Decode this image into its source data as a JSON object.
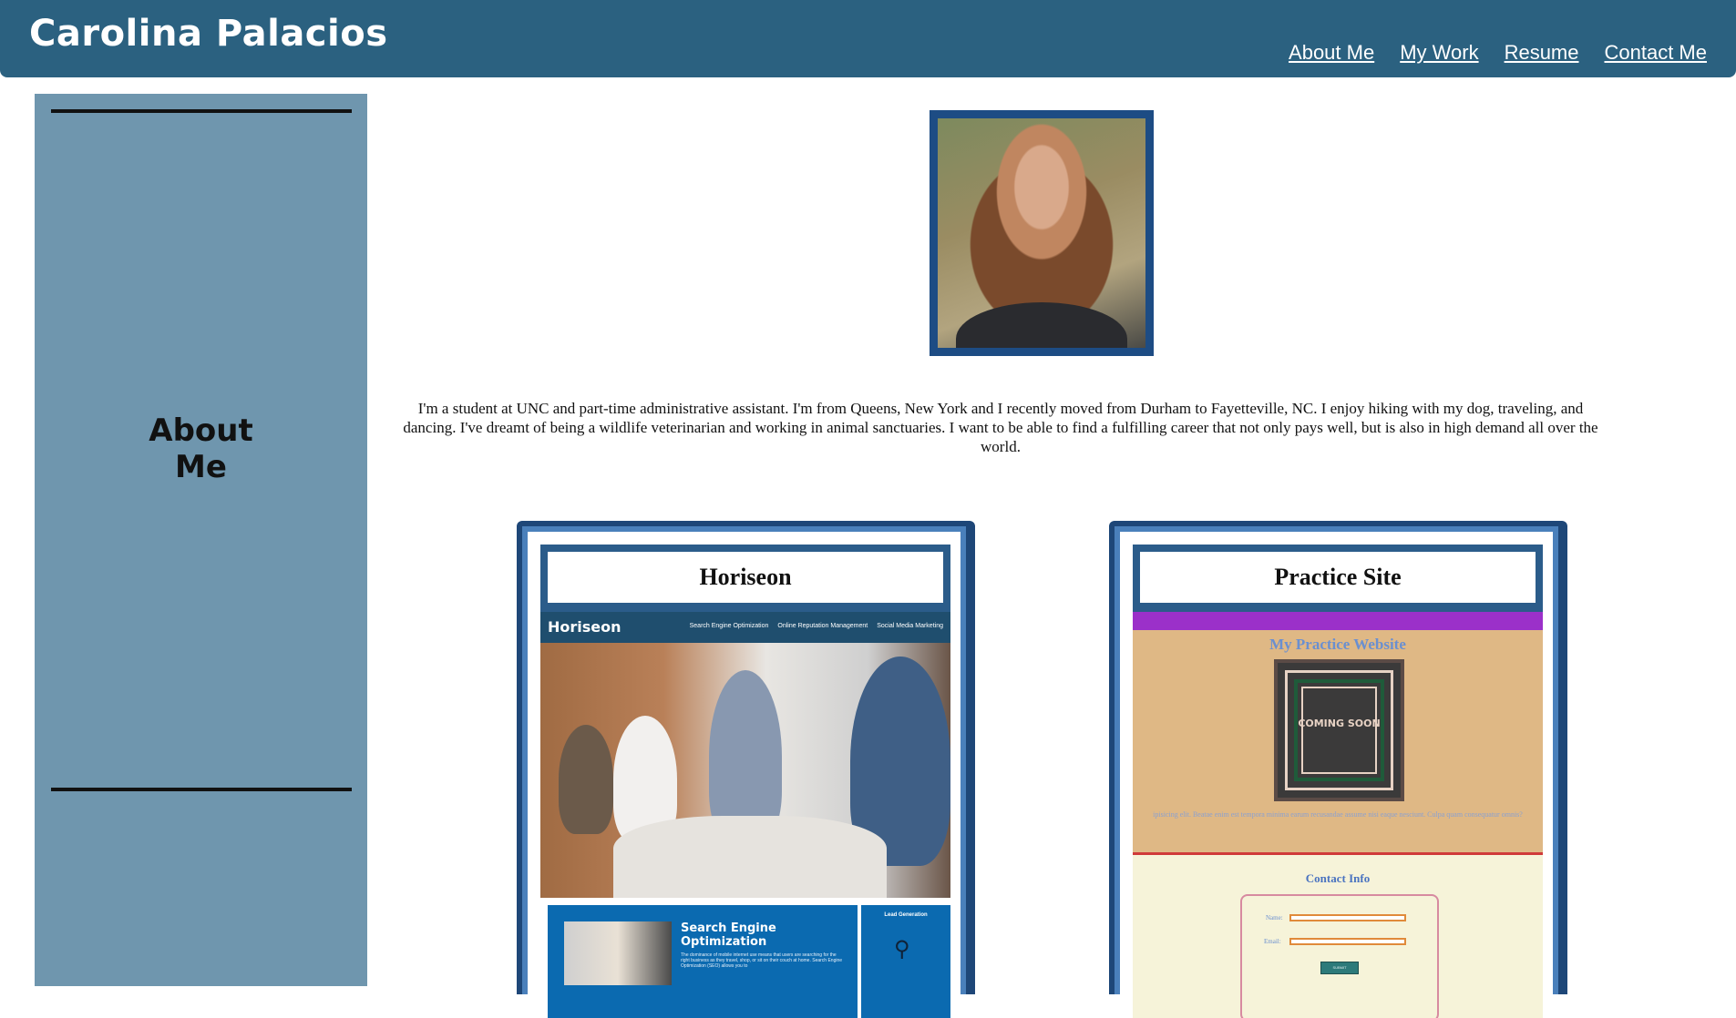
{
  "header": {
    "brand": "Carolina Palacios",
    "nav": [
      "About Me",
      "My Work",
      "Resume",
      "Contact Me"
    ],
    "bg_color": "#2b6180"
  },
  "sidebar": {
    "title_line1": "About",
    "title_line2": "Me",
    "bg_color": "#6f96ae"
  },
  "profile": {
    "bio": "I'm a student at UNC and part-time administrative assistant. I'm from Queens, New York and I recently moved from Durham to Fayetteville, NC. I enjoy hiking with my dog, traveling, and dancing. I've dreamt of being a wildlife veterinarian and working in animal sanctuaries. I want to be able to find a fulfilling career that not only pays well, but is also in high demand all over the world."
  },
  "projects": [
    {
      "title": "Horiseon",
      "preview": {
        "logo": "Horiseon",
        "nav": [
          "Search Engine Optimization",
          "Online Reputation Management",
          "Social Media Marketing"
        ],
        "section_title": "Search Engine Optimization",
        "section_text": "The dominance of mobile internet use means that users are searching for the right business as they travel, shop, or sit on their couch at home. Search Engine Optimization (SEO) allows you to",
        "side_title": "Lead Generation"
      }
    },
    {
      "title": "Practice Site",
      "preview": {
        "heading": "My Practice Website",
        "coming_soon": "COMING SOON",
        "lorem": "ipisicing elit. Beatae enim est tempora minima earum recusandae assume nisi eaque nesciunt. Culpa quam consequatur omnis?",
        "contact_title": "Contact Info",
        "name_label": "Name:",
        "email_label": "Email:",
        "submit_label": "SUBMIT"
      }
    }
  ]
}
